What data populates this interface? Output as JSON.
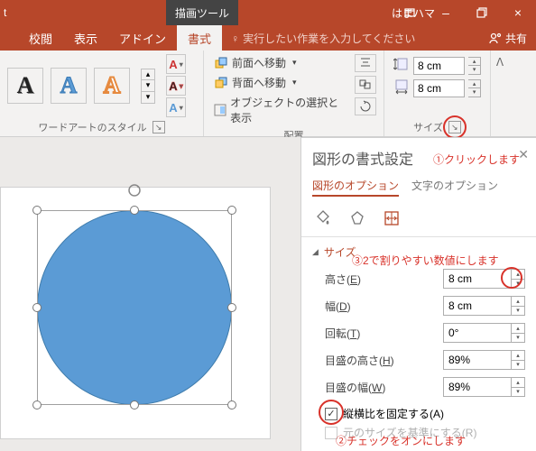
{
  "titlebar": {
    "app_suffix": "t",
    "tool_tab": "描画ツール",
    "user": "はまハマ",
    "min": "–",
    "close": "×"
  },
  "tabs": {
    "review": "校閲",
    "view": "表示",
    "addin": "アドイン",
    "format": "書式",
    "tell": "実行したい作業を入力してください",
    "share": "共有"
  },
  "ribbon": {
    "wordart_letter": "A",
    "group_wordart": "ワードアートのスタイル",
    "more_glyph": "⋯",
    "arrange": {
      "forward": "前面へ移動",
      "backward": "背面へ移動",
      "selection": "オブジェクトの選択と表示",
      "group": "配置"
    },
    "size": {
      "height": "8 cm",
      "width": "8 cm",
      "group": "サイズ"
    }
  },
  "pane": {
    "title": "図形の書式設定",
    "tab_shape": "図形のオプション",
    "tab_text": "文字のオプション",
    "section": "サイズ",
    "height_label_pre": "高さ(",
    "height_label_u": "E",
    "height_label_post": ")",
    "height_val": "8 cm",
    "width_label_pre": "幅(",
    "width_label_u": "D",
    "width_label_post": ")",
    "width_val": "8 cm",
    "rotation_label_pre": "回転(",
    "rotation_label_u": "T",
    "rotation_label_post": ")",
    "rotation_val": "0°",
    "scale_h_pre": "目盛の高さ(",
    "scale_h_u": "H",
    "scale_h_post": ")",
    "scale_h_val": "89%",
    "scale_w_pre": "目盛の幅(",
    "scale_w_u": "W",
    "scale_w_post": ")",
    "scale_w_val": "89%",
    "lock_aspect_pre": "縦横比を固定する(",
    "lock_aspect_u": "A",
    "lock_aspect_post": ")",
    "orig_size_pre": "元のサイズを基準にする(",
    "orig_size_u": "R",
    "orig_size_post": ")",
    "check": "✓"
  },
  "callouts": {
    "c1": "①クリックします",
    "c2": "②チェックをオンにします",
    "c3": "③2で割りやすい数値にします"
  }
}
